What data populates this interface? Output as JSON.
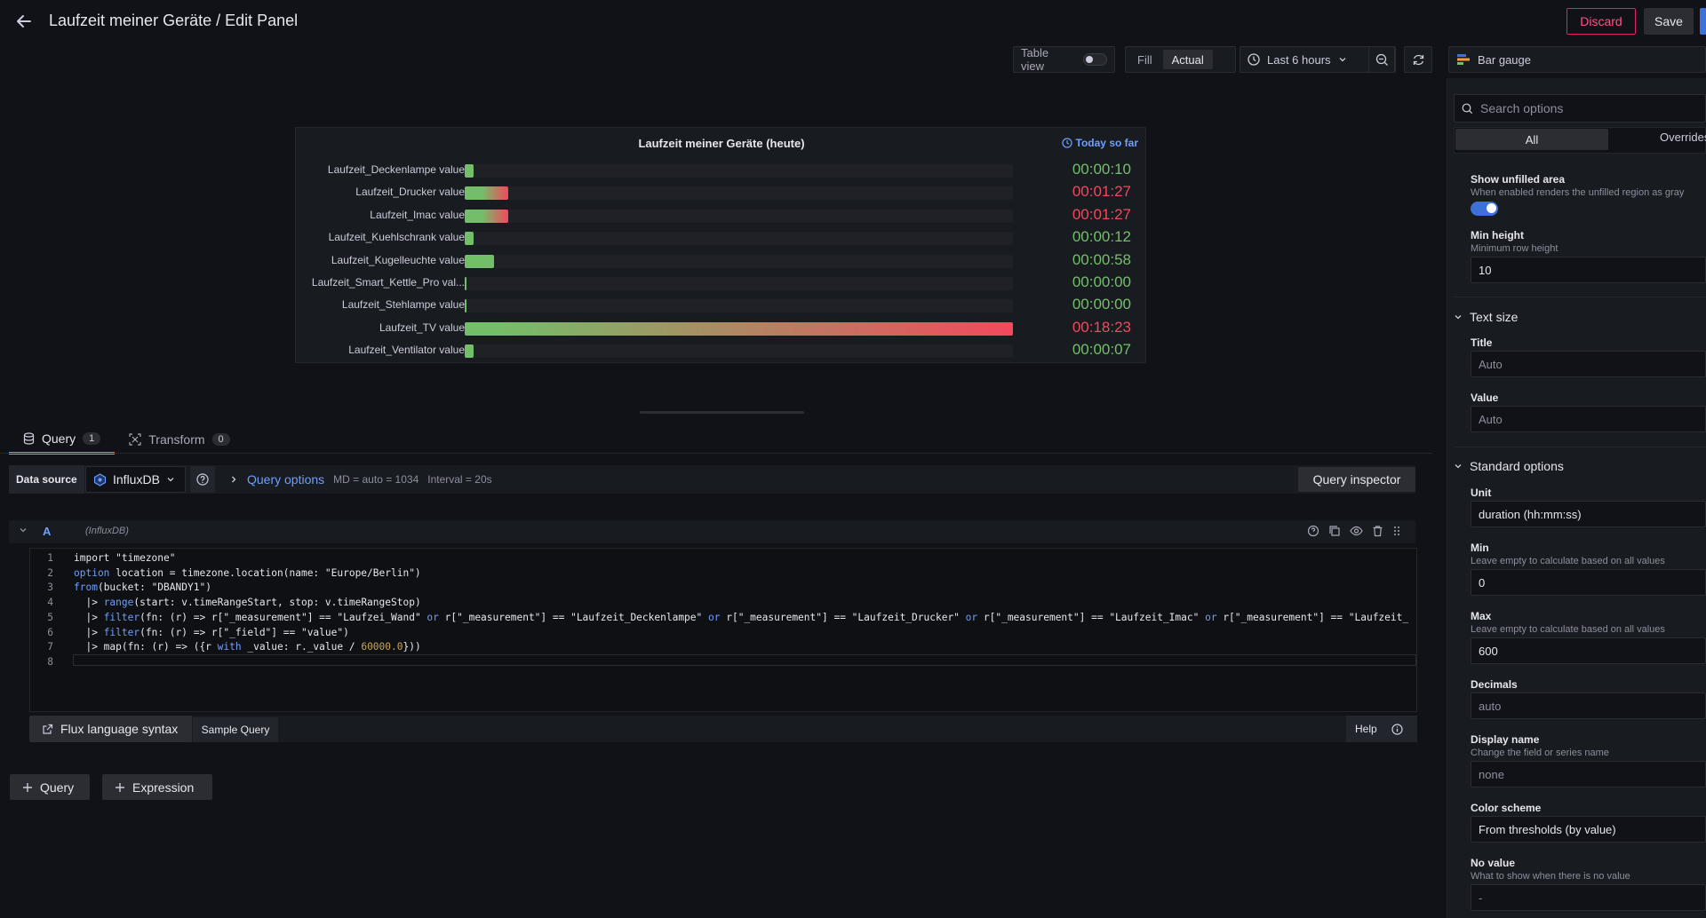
{
  "header": {
    "title": "Laufzeit meiner Geräte / Edit Panel",
    "discard_label": "Discard",
    "save_label": "Save"
  },
  "toolbar": {
    "table_view_label": "Table view",
    "fill_label": "Fill",
    "actual_label": "Actual",
    "time_range": "Last 6 hours",
    "visualization": "Bar gauge"
  },
  "panel": {
    "title": "Laufzeit meiner Geräte (heute)",
    "time_info": "Today so far",
    "rows": [
      {
        "label": "Laufzeit_Deckenlampe value",
        "value": "00:00:10",
        "minutes": 0.17,
        "color": "#73bf69"
      },
      {
        "label": "Laufzeit_Drucker value",
        "value": "00:01:27",
        "minutes": 1.45,
        "color": "#f2495c"
      },
      {
        "label": "Laufzeit_Imac value",
        "value": "00:01:27",
        "minutes": 1.45,
        "color": "#f2495c"
      },
      {
        "label": "Laufzeit_Kuehlschrank value",
        "value": "00:00:12",
        "minutes": 0.2,
        "color": "#73bf69"
      },
      {
        "label": "Laufzeit_Kugelleuchte value",
        "value": "00:00:58",
        "minutes": 0.97,
        "color": "#73bf69"
      },
      {
        "label": "Laufzeit_Smart_Kettle_Pro val...",
        "value": "00:00:00",
        "minutes": 0,
        "color": "#73bf69"
      },
      {
        "label": "Laufzeit_Stehlampe value",
        "value": "00:00:00",
        "minutes": 0,
        "color": "#73bf69"
      },
      {
        "label": "Laufzeit_TV value",
        "value": "00:18:23",
        "minutes": 18.38,
        "color": "#f2495c"
      },
      {
        "label": "Laufzeit_Ventilator value",
        "value": "00:00:07",
        "minutes": 0.12,
        "color": "#73bf69"
      }
    ],
    "colors": {
      "low": "#73bf69",
      "high": "#f2495c"
    }
  },
  "query_tabs": [
    {
      "label": "Query",
      "count": "1"
    },
    {
      "label": "Transform",
      "count": "0"
    }
  ],
  "query_bar": {
    "ds_label": "Data source",
    "ds_name": "InfluxDB",
    "options_label": "Query options",
    "md": "MD = auto = 1034",
    "interval": "Interval = 20s",
    "inspector_label": "Query inspector"
  },
  "query_row": {
    "letter": "A",
    "datasource": "(InfluxDB)"
  },
  "code": [
    {
      "n": "1",
      "parts": [
        [
          "",
          "import \"timezone\""
        ]
      ]
    },
    {
      "n": "2",
      "parts": [
        [
          "kw",
          "option"
        ],
        [
          "",
          " location = timezone.location(name: \"Europe/Berlin\")"
        ]
      ]
    },
    {
      "n": "3",
      "parts": [
        [
          "kw",
          "from"
        ],
        [
          "",
          "(bucket: \"DBANDY1\")"
        ]
      ]
    },
    {
      "n": "4",
      "parts": [
        [
          "",
          "  |> "
        ],
        [
          "kw",
          "range"
        ],
        [
          "",
          "(start: v.timeRangeStart, stop: v.timeRangeStop)"
        ]
      ]
    },
    {
      "n": "5",
      "parts": [
        [
          "",
          "  |> "
        ],
        [
          "kw",
          "filter"
        ],
        [
          "",
          "(fn: (r) => r[\"_measurement\"] == \"Laufzei_Wand\" "
        ],
        [
          "kw",
          "or"
        ],
        [
          "",
          " r[\"_measurement\"] == \"Laufzeit_Deckenlampe\" "
        ],
        [
          "kw",
          "or"
        ],
        [
          "",
          " r[\"_measurement\"] == \"Laufzeit_Drucker\" "
        ],
        [
          "kw",
          "or"
        ],
        [
          "",
          " r[\"_measurement\"] == \"Laufzeit_Imac\" "
        ],
        [
          "kw",
          "or"
        ],
        [
          "",
          " r[\"_measurement\"] == \"Laufzeit_"
        ]
      ]
    },
    {
      "n": "6",
      "parts": [
        [
          "",
          "  |> "
        ],
        [
          "kw",
          "filter"
        ],
        [
          "",
          "(fn: (r) => r[\"_field\"] == \"value\")"
        ]
      ]
    },
    {
      "n": "7",
      "parts": [
        [
          "",
          "  |> map(fn: (r) => ({r "
        ],
        [
          "kw",
          "with"
        ],
        [
          "",
          " _value: r._value / "
        ],
        [
          "num",
          "60000.0"
        ],
        [
          "",
          "}))"
        ]
      ]
    },
    {
      "n": "8",
      "parts": [
        [
          "",
          ""
        ]
      ]
    }
  ],
  "editor_footer": {
    "flux_label": "Flux language syntax",
    "sample_label": "Sample Query",
    "help_label": "Help"
  },
  "add_buttons": {
    "query": "Query",
    "expression": "Expression"
  },
  "options": {
    "search_placeholder": "Search options",
    "tab_all": "All",
    "tab_overrides": "Overrides",
    "show_unfilled_label": "Show unfilled area",
    "show_unfilled_desc": "When enabled renders the unfilled region as gray",
    "min_height_label": "Min height",
    "min_height_desc": "Minimum row height",
    "min_height_value": "10",
    "text_size_section": "Text size",
    "title_label": "Title",
    "title_placeholder": "Auto",
    "value_label": "Value",
    "value_placeholder": "Auto",
    "standard_section": "Standard options",
    "unit_label": "Unit",
    "unit_value": "duration (hh:mm:ss)",
    "min_label": "Min",
    "min_desc": "Leave empty to calculate based on all values",
    "min_value": "0",
    "max_label": "Max",
    "max_desc": "Leave empty to calculate based on all values",
    "max_value": "600",
    "decimals_label": "Decimals",
    "decimals_placeholder": "auto",
    "display_name_label": "Display name",
    "display_name_desc": "Change the field or series name",
    "display_name_placeholder": "none",
    "color_scheme_label": "Color scheme",
    "color_scheme_value": "From thresholds (by value)",
    "no_value_label": "No value",
    "no_value_desc": "What to show when there is no value",
    "no_value_placeholder": "-"
  }
}
